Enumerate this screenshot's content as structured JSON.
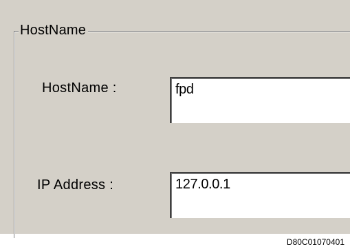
{
  "group": {
    "title": "HostName"
  },
  "fields": {
    "hostname_label": "HostName :",
    "hostname_value": "fpd",
    "ip_label": "IP Address :",
    "ip_value": "127.0.0.1"
  },
  "caption": "D80C01070401",
  "colors": {
    "dialog_background": "#d4d0c8",
    "field_background": "#ffffff"
  }
}
